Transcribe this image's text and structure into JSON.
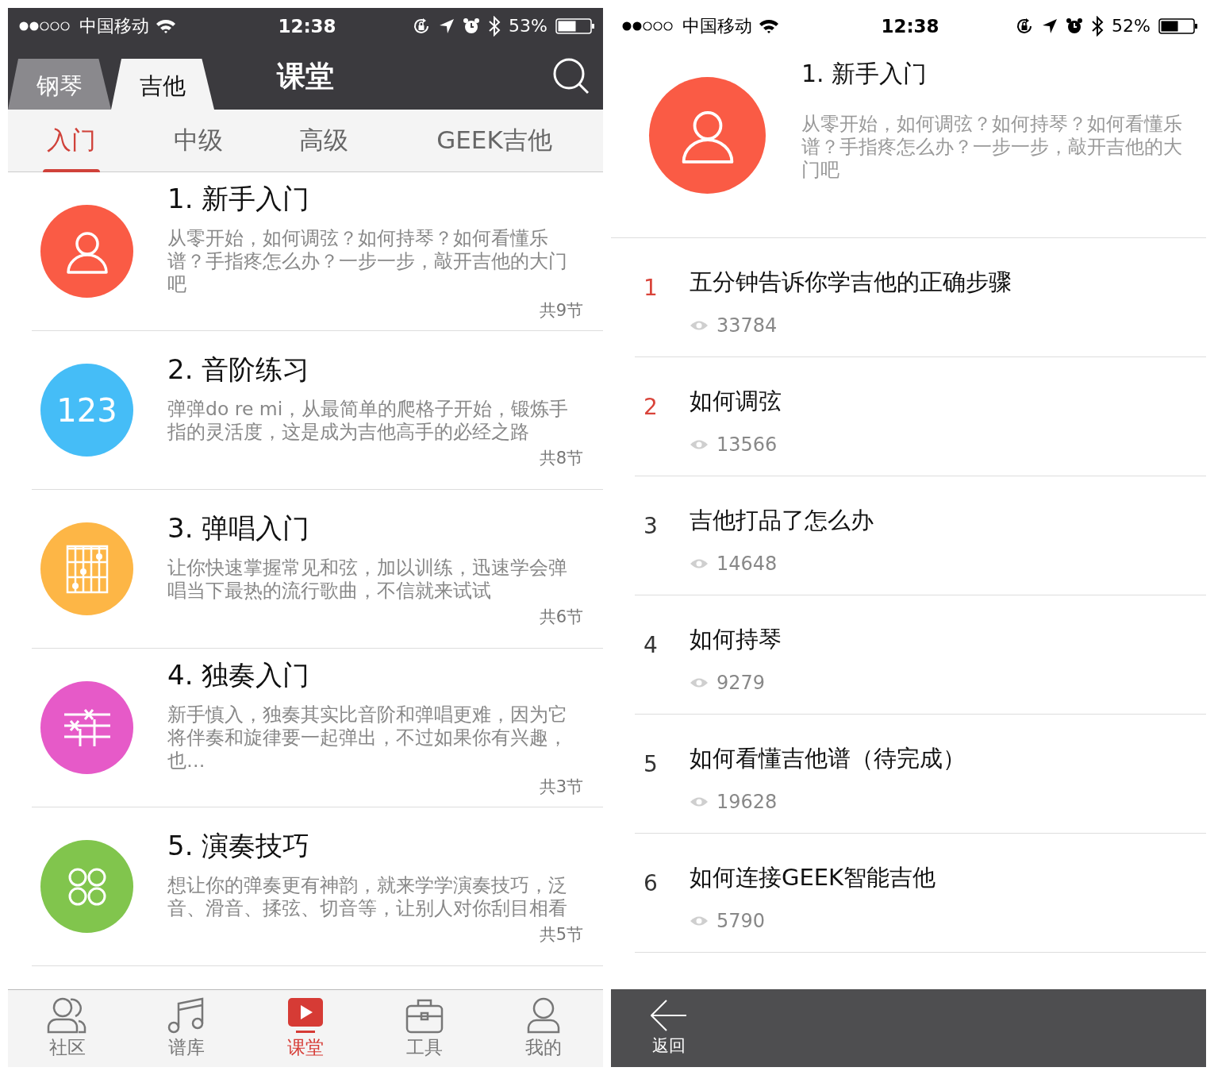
{
  "left": {
    "status_bar": {
      "carrier": "中国移动",
      "time": "12:38",
      "battery": "53%"
    },
    "instrument_tabs": [
      {
        "label": "钢琴",
        "selected": false
      },
      {
        "label": "吉他",
        "selected": true
      }
    ],
    "title": "课堂",
    "level_tabs": [
      {
        "label": "入门",
        "selected": true
      },
      {
        "label": "中级",
        "selected": false
      },
      {
        "label": "高级",
        "selected": false
      },
      {
        "label": "GEEK吉他",
        "selected": false
      }
    ],
    "courses": [
      {
        "kind": "person",
        "color": "#fa5b45",
        "title": "1.  新手入门",
        "description": "从零开始，如何调弦？如何持琴？如何看懂乐谱？手指疼怎么办？一步一步，敲开吉他的大门吧",
        "count": "共9节"
      },
      {
        "kind": "digits",
        "icon_text": "123",
        "color": "#45bdf7",
        "title": "2.  音阶练习",
        "description": "弹弹do re mi，从最简单的爬格子开始，锻炼手指的灵活度，这是成为吉他高手的必经之路",
        "count": "共8节"
      },
      {
        "kind": "chord",
        "color": "#fdb646",
        "title": "3.  弹唱入门",
        "description": "让你快速掌握常见和弦，加以训练，迅速学会弹唱当下最热的流行歌曲，不信就来试试",
        "count": "共6节"
      },
      {
        "kind": "solo",
        "color": "#e65ac8",
        "title": "4. 独奏入门",
        "description": "新手慎入，独奏其实比音阶和弹唱更难，因为它将伴奏和旋律要一起弹出，不过如果你有兴趣，也…",
        "count": "共3节"
      },
      {
        "kind": "circles",
        "color": "#81c54d",
        "title": "5.  演奏技巧",
        "description": "想让你的弹奏更有神韵，就来学学演奏技巧，泛音、滑音、揉弦、切音等，让别人对你刮目相看",
        "count": "共5节"
      }
    ],
    "tab_bar": [
      {
        "kind": "community",
        "label": "社区",
        "selected": false
      },
      {
        "kind": "music",
        "label": "谱库",
        "selected": false
      },
      {
        "kind": "play",
        "label": "课堂",
        "selected": true
      },
      {
        "kind": "toolbox",
        "label": "工具",
        "selected": false
      },
      {
        "kind": "person",
        "label": "我的",
        "selected": false
      }
    ]
  },
  "right": {
    "status_bar": {
      "carrier": "中国移动",
      "time": "12:38",
      "battery": "52%"
    },
    "course": {
      "color": "#fa5b45",
      "title": "1.  新手入门",
      "description": "从零开始，如何调弦？如何持琴？如何看懂乐谱？手指疼怎么办？一步一步，敲开吉他的大门吧"
    },
    "lessons": [
      {
        "number": "1",
        "color": "#d9443a",
        "title": "五分钟告诉你学吉他的正确步骤",
        "views": "33784"
      },
      {
        "number": "2",
        "color": "#d9443a",
        "title": "如何调弦",
        "views": "13566"
      },
      {
        "number": "3",
        "color": "#333333",
        "title": "吉他打品了怎么办",
        "views": "14648"
      },
      {
        "number": "4",
        "color": "#333333",
        "title": "如何持琴",
        "views": "9279"
      },
      {
        "number": "5",
        "color": "#333333",
        "title": "如何看懂吉他谱（待完成）",
        "views": "19628"
      },
      {
        "number": "6",
        "color": "#333333",
        "title": "如何连接GEEK智能吉他",
        "views": "5790"
      }
    ],
    "back_button": "返回"
  }
}
